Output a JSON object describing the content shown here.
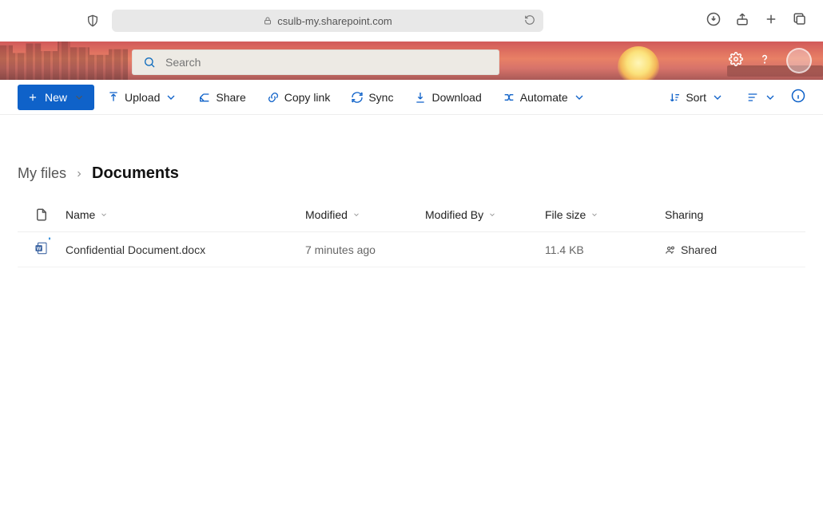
{
  "browser": {
    "url_host": "csulb-my.sharepoint.com"
  },
  "search": {
    "placeholder": "Search"
  },
  "commands": {
    "new": "New",
    "upload": "Upload",
    "share": "Share",
    "copy_link": "Copy link",
    "sync": "Sync",
    "download": "Download",
    "automate": "Automate",
    "sort": "Sort"
  },
  "breadcrumb": {
    "root": "My files",
    "current": "Documents"
  },
  "columns": {
    "name": "Name",
    "modified": "Modified",
    "modified_by": "Modified By",
    "file_size": "File size",
    "sharing": "Sharing"
  },
  "rows": [
    {
      "name": "Confidential Document.docx",
      "modified": "7 minutes ago",
      "modified_by": "",
      "file_size": "11.4 KB",
      "sharing": "Shared"
    }
  ]
}
